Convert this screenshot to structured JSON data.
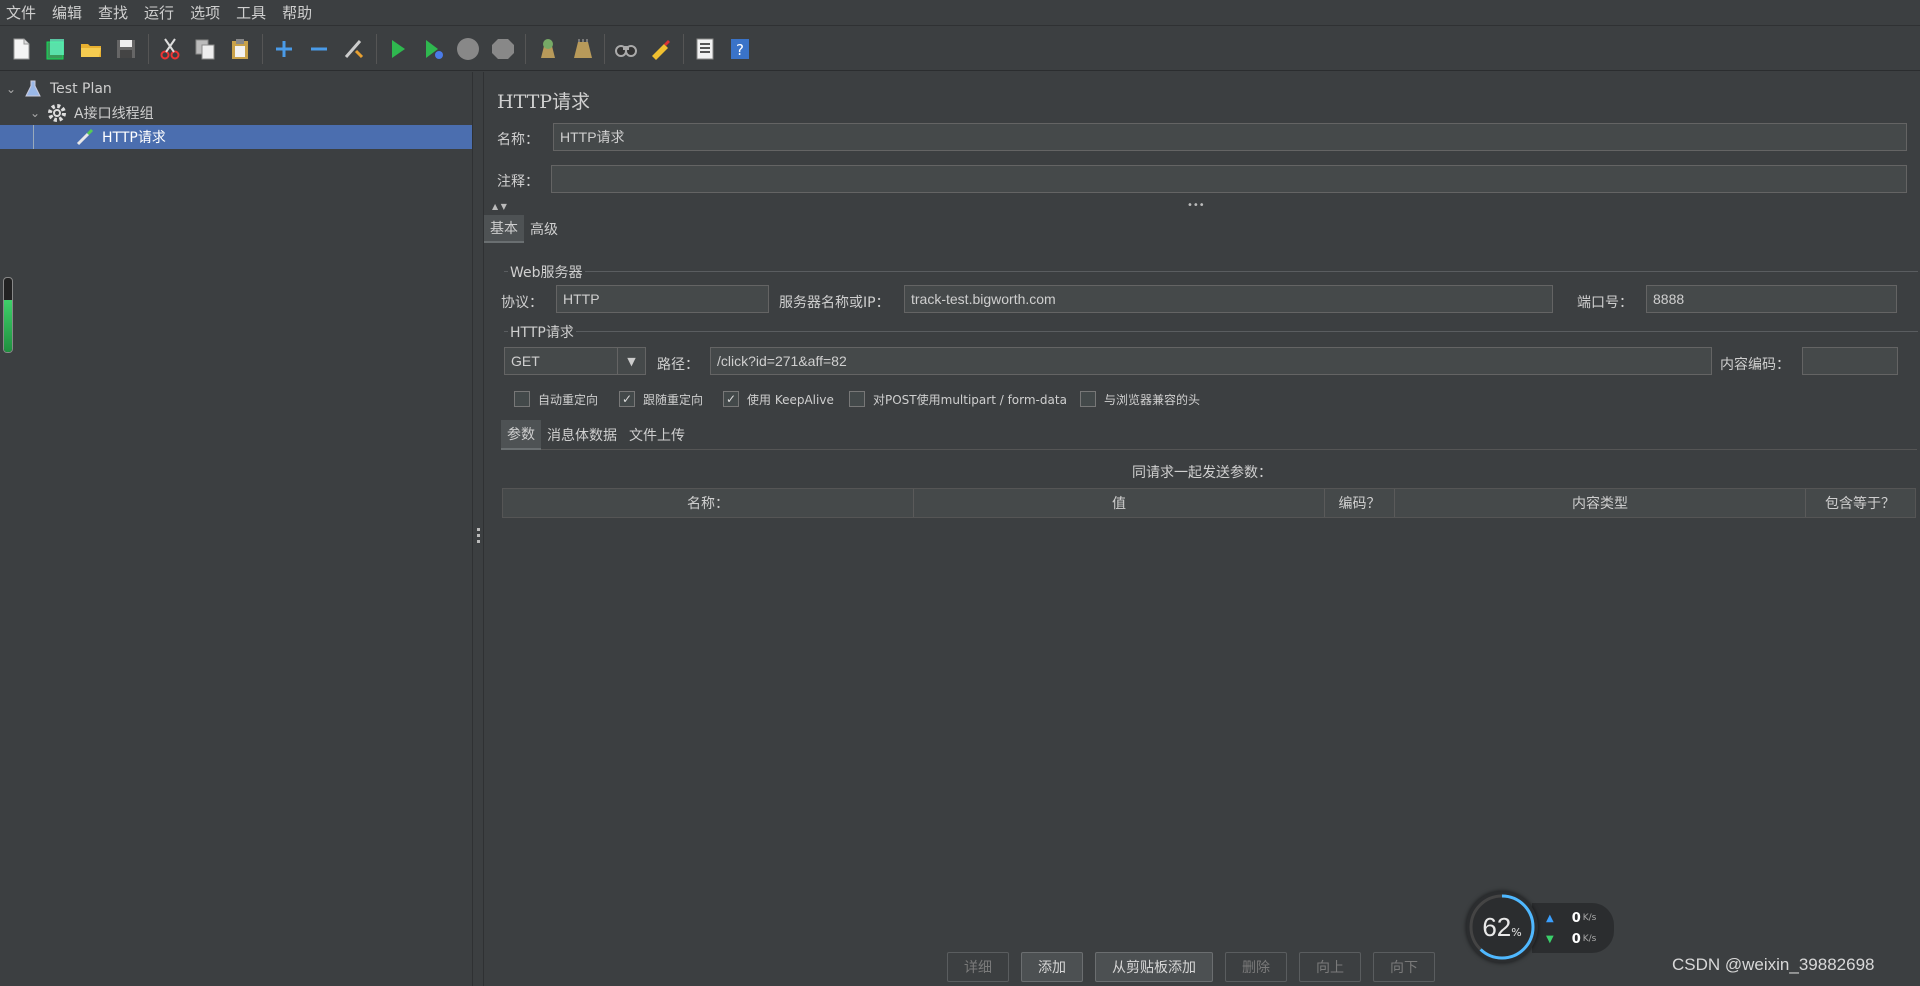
{
  "menu": [
    "文件",
    "编辑",
    "查找",
    "运行",
    "选项",
    "工具",
    "帮助"
  ],
  "toolbar_icons": [
    "new-icon",
    "templates-icon",
    "open-icon",
    "save-icon",
    "cut-icon",
    "copy-icon",
    "paste-icon",
    "expand-icon",
    "collapse-icon",
    "toggle-icon",
    "start-icon",
    "start-no-pause-icon",
    "stop-icon",
    "shutdown-icon",
    "clear-icon",
    "clear-all-icon",
    "search-icon",
    "reset-search-icon",
    "function-helper-icon",
    "help-icon"
  ],
  "tree": {
    "items": [
      {
        "label": "Test Plan",
        "icon": "flask-icon"
      },
      {
        "label": "A接口线程组",
        "icon": "gear-icon"
      },
      {
        "label": "HTTP请求",
        "icon": "pipette-icon"
      }
    ],
    "memory_level": 0.7
  },
  "panel": {
    "title": "HTTP请求",
    "name_label": "名称：",
    "name_value": "HTTP请求",
    "comment_label": "注释：",
    "comment_value": "",
    "tabs": [
      "基本",
      "高级"
    ],
    "web_server": {
      "group_title": "Web服务器",
      "protocol_label": "协议：",
      "protocol_value": "HTTP",
      "server_label": "服务器名称或IP：",
      "server_value": "track-test.bigworth.com",
      "port_label": "端口号：",
      "port_value": "8888"
    },
    "http_request": {
      "group_title": "HTTP请求",
      "method": "GET",
      "path_label": "路径：",
      "path_value": "/click?id=271&aff=82",
      "encoding_label": "内容编码：",
      "encoding_value": ""
    },
    "checkboxes": [
      {
        "label": "自动重定向",
        "checked": false
      },
      {
        "label": "跟随重定向",
        "checked": true
      },
      {
        "label": "使用 KeepAlive",
        "checked": true
      },
      {
        "label": "对POST使用multipart / form-data",
        "checked": false
      },
      {
        "label": "与浏览器兼容的头",
        "checked": false
      }
    ],
    "sub_tabs": [
      "参数",
      "消息体数据",
      "文件上传"
    ],
    "send_params_label": "同请求一起发送参数：",
    "table_headers": [
      "名称：",
      "值",
      "编码？",
      "内容类型",
      "包含等于？"
    ],
    "buttons": [
      {
        "label": "详细",
        "enabled": false
      },
      {
        "label": "添加",
        "enabled": true
      },
      {
        "label": "从剪贴板添加",
        "enabled": true
      },
      {
        "label": "删除",
        "enabled": false
      },
      {
        "label": "向上",
        "enabled": false
      },
      {
        "label": "向下",
        "enabled": false
      }
    ]
  },
  "net_widget": {
    "percent": "62",
    "percent_sign": "%",
    "up": "0",
    "down": "0",
    "unit": "K/s"
  },
  "watermark": "CSDN @weixin_39882698"
}
